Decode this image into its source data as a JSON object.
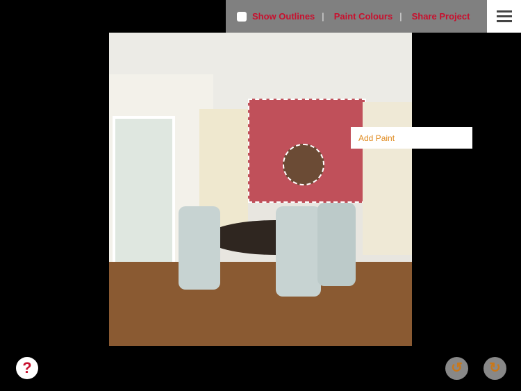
{
  "toolbar": {
    "show_outlines": "Show Outlines",
    "show_outlines_checked": false,
    "paint_colours": "Paint Colours",
    "share_project": "Share Project",
    "separator": "|"
  },
  "icons": {
    "menu": "hamburger-icon",
    "help": "question-icon",
    "undo": "undo-icon",
    "redo": "redo-icon"
  },
  "context_menu": {
    "add_paint": "Add Paint"
  },
  "help": {
    "label": "?"
  },
  "colors": {
    "accent": "#c8102e",
    "wall_paint": "#c0505a",
    "toolbar_bg": "#808080",
    "undo_redo": "#c9781a"
  }
}
